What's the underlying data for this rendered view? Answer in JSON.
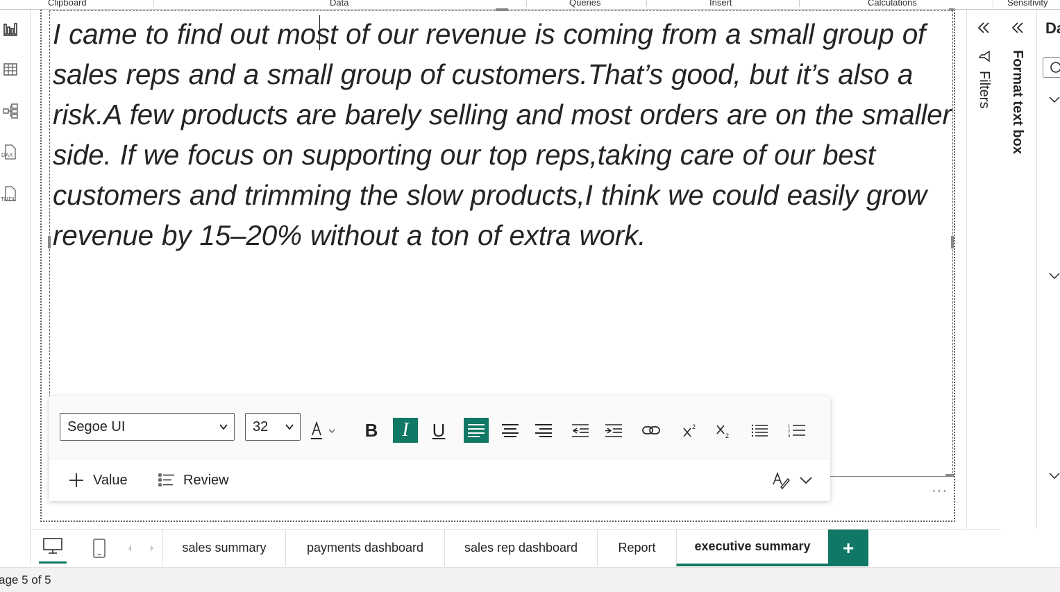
{
  "ribbon": {
    "groups": [
      "Clipboard",
      "Data",
      "Queries",
      "Insert",
      "Calculations",
      "Sensitivity"
    ]
  },
  "left_rail": {
    "icons": [
      "report-view-icon",
      "table-view-icon",
      "model-view-icon",
      "dax-query-icon",
      "tmdl-view-icon"
    ],
    "dax_label": "DAX",
    "tmdl_label": "TMDL"
  },
  "textbox": {
    "text": "I came to find out most of our revenue is coming from a small group of sales reps and a small group of customers.That’s good, but it’s also a risk.A few products are barely selling and most orders are on the smaller side. If we focus on supporting our top reps,taking care of our best customers and trimming the slow products,I think we could easily grow revenue by 15–20% without a ton of extra work."
  },
  "format_toolbar": {
    "font_family": "Segoe UI",
    "font_size": "32",
    "bold_label": "B",
    "italic_label": "I",
    "underline_label": "U",
    "italic_active": true,
    "align_left_active": true,
    "value_label": "Value",
    "review_label": "Review",
    "accent_color": "#117865"
  },
  "right_panes": {
    "filters_label": "Filters",
    "format_label": "Format text box",
    "data_label_partial": "Da"
  },
  "page_tabs": {
    "tabs": [
      {
        "label": "sales summary",
        "active": false
      },
      {
        "label": "payments dashboard",
        "active": false
      },
      {
        "label": "sales rep dashboard",
        "active": false
      },
      {
        "label": "Report",
        "active": false
      },
      {
        "label": "executive summary",
        "active": true
      }
    ],
    "add_label": "+"
  },
  "status": {
    "page_indicator": "age 5 of 5"
  }
}
